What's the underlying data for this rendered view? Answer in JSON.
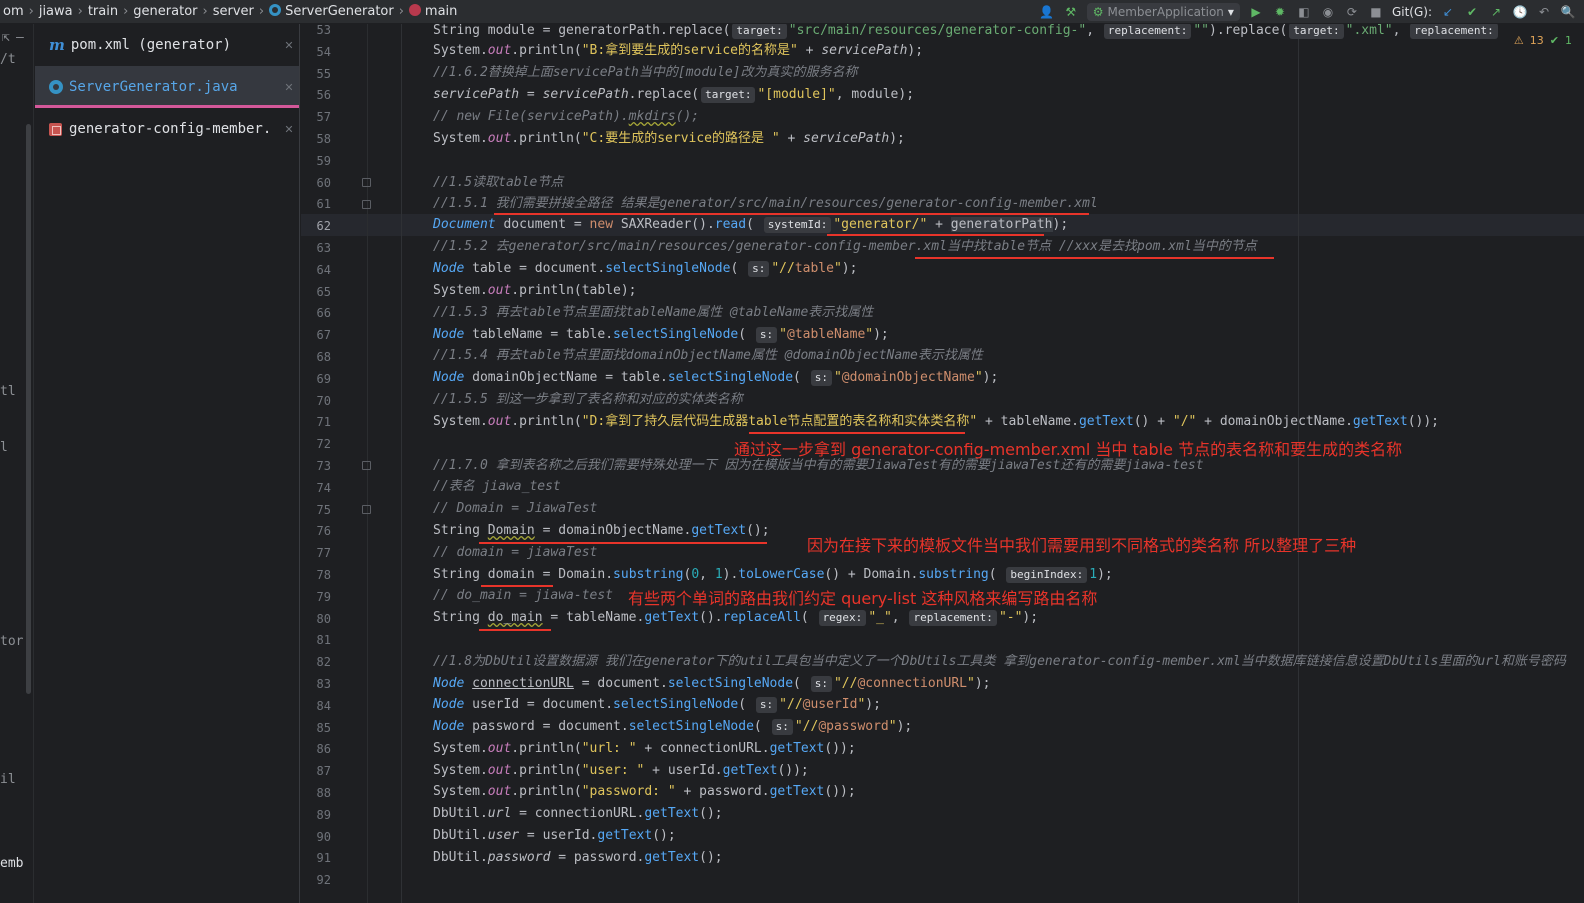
{
  "breadcrumb": [
    "om",
    "jiawa",
    "train",
    "generator",
    "server",
    "ServerGenerator",
    "main"
  ],
  "toolbar": {
    "run_config": "MemberApplication",
    "git_label": "Git(G):"
  },
  "left_strip": [
    "/t",
    "tl",
    "l",
    "tor",
    "il",
    "emb"
  ],
  "tabs": [
    {
      "label": "pom.xml (generator)",
      "icon": "maven-icon"
    },
    {
      "label": "ServerGenerator.java",
      "icon": "class-icon"
    },
    {
      "label": "generator-config-member.",
      "icon": "xml-icon"
    }
  ],
  "inspections": {
    "warnings": "13",
    "ok": "1"
  },
  "editor": {
    "line_numbers": [
      "53",
      "54",
      "55",
      "56",
      "57",
      "58",
      "59",
      "60",
      "61",
      "62",
      "63",
      "64",
      "65",
      "66",
      "67",
      "68",
      "69",
      "70",
      "71",
      "72",
      "73",
      "74",
      "75",
      "76",
      "77",
      "78",
      "79",
      "80",
      "81",
      "82",
      "83",
      "84",
      "85",
      "86",
      "87",
      "88",
      "89",
      "90",
      "91",
      "92"
    ],
    "current_line": "62",
    "lines": {
      "l53": {
        "pre": "String module = generatorPath.replace(",
        "h1": "target:",
        "s1": "\"src/main/resources/generator-config-\"",
        "mid": ", ",
        "h2": "replacement:",
        "s2": "\"\"",
        "post": ").replace(",
        "h3": "target:",
        "s3": "\".xml\"",
        "post2": ", ",
        "h4": "replacement:"
      },
      "l54": {
        "a": "System.",
        "b": "out",
        "c": ".println(",
        "s": "\"B:拿到要生成的service的名称是\"",
        "d": " + ",
        "e": "servicePath",
        "f": ");"
      },
      "l55": "//1.6.2替换掉上面servicePath当中的[module]改为真实的服务名称",
      "l56": {
        "a": "servicePath",
        "b": " = ",
        "c": "servicePath",
        "d": ".replace(",
        "h": "target:",
        "s": "\"[module]\"",
        "e": ", module);"
      },
      "l57": {
        "a": "// new File(servicePath).",
        "b": "mkdirs",
        "c": "();"
      },
      "l58": {
        "a": "System.",
        "b": "out",
        "c": ".println(",
        "s": "\"C:要生成的service的路径是 \"",
        "d": " + ",
        "e": "servicePath",
        "f": ");"
      },
      "l60": "//1.5读取table节点",
      "l61": "//1.5.1 我们需要拼接全路径 结果是generator/src/main/resources/generator-config-member.xml",
      "l62": {
        "a": "Document",
        "b": " document = ",
        "c": "new",
        "d": " SAXReader().",
        "e": "read",
        "f": "( ",
        "h": "systemId:",
        "s": "\"generator/\"",
        "g": " + ",
        "i": "generatorPath",
        "j": ");"
      },
      "l63": "//1.5.2 去generator/src/main/resources/generator-config-member.xml当中找table节点 //xxx是去找pom.xml当中的节点",
      "l64": {
        "a": "Node",
        "b": " table = document.",
        "c": "selectSingleNode",
        "d": "( ",
        "h": "s:",
        "s1": "\"//",
        "s2": "table",
        "s3": "\"",
        "e": ");"
      },
      "l65": {
        "a": "System.",
        "b": "out",
        "c": ".println(table);"
      },
      "l66": "//1.5.3 再去table节点里面找tableName属性 @tableName表示找属性",
      "l67": {
        "a": "Node",
        "b": " tableName = table.",
        "c": "selectSingleNode",
        "d": "( ",
        "h": "s:",
        "s1": "\"",
        "s2": "@tableName",
        "s3": "\"",
        "e": ");"
      },
      "l68": "//1.5.4 再去table节点里面找domainObjectName属性 @domainObjectName表示找属性",
      "l69": {
        "a": "Node",
        "b": " domainObjectName = table.",
        "c": "selectSingleNode",
        "d": "( ",
        "h": "s:",
        "s1": "\"",
        "s2": "@domainObjectName",
        "s3": "\"",
        "e": ");"
      },
      "l70": "//1.5.5 到这一步拿到了表名称和对应的实体类名称",
      "l71": {
        "a": "System.",
        "b": "out",
        "c": ".println(",
        "s": "\"D:拿到了持久层代码生成器table节点配置的表名称和实体类名称\"",
        "d": " + tableName.",
        "e": "getText",
        "f": "() + ",
        "s2": "\"/\"",
        "g": " + domainObjectName.",
        "i": "getText",
        "j": "());"
      },
      "l73": "//1.7.0 拿到表名称之后我们需要特殊处理一下 因为在模版当中有的需要JiawaTest有的需要jiawaTest还有的需要jiawa-test",
      "l74": "//表名 jiawa_test",
      "l75": "// Domain = JiawaTest",
      "l76": {
        "a": "String ",
        "b": "Domain",
        "c": " = domainObjectName.",
        "d": "getText",
        "e": "();"
      },
      "l77": "// domain = jiawaTest",
      "l78": {
        "a": "String ",
        "b": "domain",
        "c": " = Domain.",
        "d": "substring",
        "e": "(",
        "n1": "0",
        "f": ", ",
        "n2": "1",
        "g": ").",
        "h2": "toLowerCase",
        "i": "() + Domain.",
        "j": "substring",
        "k": "( ",
        "h": "beginIndex:",
        "n3": "1",
        "l": ");"
      },
      "l79": "// do_main = jiawa-test",
      "l80": {
        "a": "String ",
        "b": "do_main",
        "c": " = tableName.",
        "d": "getText",
        "e": "().",
        "f": "replaceAll",
        "g": "( ",
        "h1": "regex:",
        "s1": "\"_\"",
        "m": ", ",
        "h2": "replacement:",
        "s2": "\"-\"",
        "n": ");"
      },
      "l82": "//1.8为DbUtil设置数据源 我们在generator下的util工具包当中定义了一个DbUtils工具类 拿到generator-config-member.xml当中数据库链接信息设置DbUtils里面的url和账号密码",
      "l83": {
        "a": "Node ",
        "b": "connectionURL",
        "c": " = document.",
        "d": "selectSingleNode",
        "e": "( ",
        "h": "s:",
        "s1": "\"//",
        "s2": "@connectionURL",
        "s3": "\"",
        "f": ");"
      },
      "l84": {
        "a": "Node",
        "b": " userId = document.",
        "c": "selectSingleNode",
        "d": "( ",
        "h": "s:",
        "s1": "\"//",
        "s2": "@userId",
        "s3": "\"",
        "e": ");"
      },
      "l85": {
        "a": "Node",
        "b": " password = document.",
        "c": "selectSingleNode",
        "d": "( ",
        "h": "s:",
        "s1": "\"//",
        "s2": "@password",
        "s3": "\"",
        "e": ");"
      },
      "l86": {
        "a": "System.",
        "b": "out",
        "c": ".println(",
        "s": "\"url: \"",
        "d": " + connectionURL.",
        "e": "getText",
        "f": "());"
      },
      "l87": {
        "a": "System.",
        "b": "out",
        "c": ".println(",
        "s": "\"user: \"",
        "d": " + userId.",
        "e": "getText",
        "f": "());"
      },
      "l88": {
        "a": "System.",
        "b": "out",
        "c": ".println(",
        "s": "\"password: \"",
        "d": " + password.",
        "e": "getText",
        "f": "());"
      },
      "l89": {
        "a": "DbUtil.",
        "b": "url",
        "c": " = connectionURL.",
        "d": "getText",
        "e": "();"
      },
      "l90": {
        "a": "DbUtil.",
        "b": "user",
        "c": " = userId.",
        "d": "getText",
        "e": "();"
      },
      "l91": {
        "a": "DbUtil.",
        "b": "password",
        "c": " = password.",
        "d": "getText",
        "e": "();"
      }
    }
  },
  "annotations": {
    "a1": "通过这一步拿到 generator-config-member.xml 当中 table 节点的表名称和要生成的类名称",
    "a2": "因为在接下来的模板文件当中我们需要用到不同格式的类名称 所以整理了三种",
    "a3": "有些两个单词的路由我们约定 query-list 这种风格来编写路由名称"
  },
  "colors": {
    "annotation": "#e8342a",
    "active_tab_underline": "#d4589a"
  }
}
